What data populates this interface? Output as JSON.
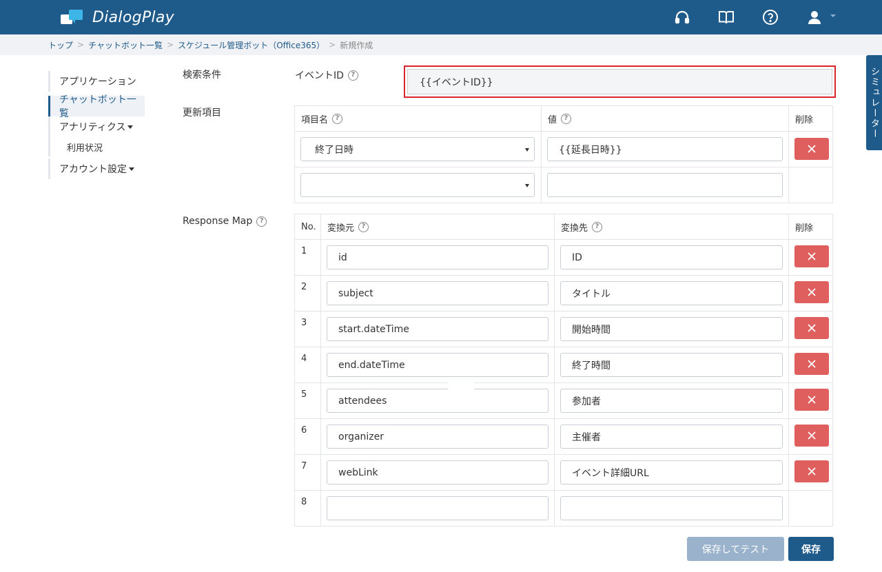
{
  "app": {
    "name": "DialogPlay"
  },
  "header": {
    "icons": [
      "headset-icon",
      "book-icon",
      "help-icon",
      "user-icon"
    ]
  },
  "breadcrumb": {
    "items": [
      "トップ",
      "チャットボット一覧",
      "スケジュール管理ボット（Office365）"
    ],
    "current": "新規作成"
  },
  "sidebar": {
    "items": [
      {
        "label": "アプリケーション"
      },
      {
        "label": "チャットボット一覧"
      },
      {
        "label": "アナリティクス"
      },
      {
        "label": "利用状況"
      },
      {
        "label": "アカウント設定"
      }
    ]
  },
  "simulator_tab": "シミュレーター",
  "search": {
    "section_label": "検索条件",
    "field_label": "イベントID",
    "value": "{{イベントID}}"
  },
  "update": {
    "section_label": "更新項目",
    "headers": {
      "name": "項目名",
      "value": "値",
      "delete": "削除"
    },
    "rows": [
      {
        "name": "終了日時",
        "value": "{{延長日時}}"
      },
      {
        "name": "",
        "value": ""
      }
    ]
  },
  "response_map": {
    "section_label": "Response Map",
    "headers": {
      "no": "No.",
      "source": "変換元",
      "target": "変換先",
      "delete": "削除"
    },
    "rows": [
      {
        "no": "1",
        "source": "id",
        "target": "ID"
      },
      {
        "no": "2",
        "source": "subject",
        "target": "タイトル"
      },
      {
        "no": "3",
        "source": "start.dateTime",
        "target": "開始時間"
      },
      {
        "no": "4",
        "source": "end.dateTime",
        "target": "終了時間"
      },
      {
        "no": "5",
        "source": "attendees",
        "target": "参加者"
      },
      {
        "no": "6",
        "source": "organizer",
        "target": "主催者"
      },
      {
        "no": "7",
        "source": "webLink",
        "target": "イベント詳細URL"
      },
      {
        "no": "8",
        "source": "",
        "target": ""
      }
    ]
  },
  "actions": {
    "save_test": "保存してテスト",
    "save": "保存"
  },
  "colors": {
    "brand": "#1e5a8a",
    "danger": "#df5e5e",
    "highlight": "#d9232d"
  }
}
